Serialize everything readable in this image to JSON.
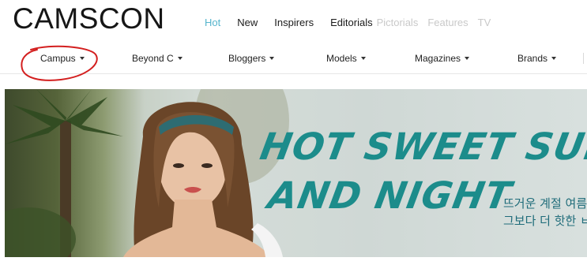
{
  "brand": {
    "logo_text": "CAMSCON"
  },
  "top_nav": {
    "items": [
      {
        "label": "Hot",
        "state": "active"
      },
      {
        "label": "New",
        "state": "normal"
      },
      {
        "label": "Inspirers",
        "state": "normal"
      },
      {
        "label": "Editorials",
        "state": "normal"
      },
      {
        "label": "Pictorials",
        "state": "dimmed"
      },
      {
        "label": "Features",
        "state": "dimmed"
      },
      {
        "label": "TV",
        "state": "dimmed"
      }
    ]
  },
  "sub_nav": {
    "items": [
      {
        "label": "Campus"
      },
      {
        "label": "Beyond C"
      },
      {
        "label": "Bloggers"
      },
      {
        "label": "Models"
      },
      {
        "label": "Magazines"
      },
      {
        "label": "Brands"
      }
    ]
  },
  "hero": {
    "headline_line1": "HOT SWEET SUMME",
    "headline_line2": "AND NIGHT",
    "subtitle_line1": "뜨거운 계절 여름",
    "subtitle_line2": "그보다 더 핫한 ㅂ"
  },
  "colors": {
    "accent": "#57b5cd",
    "headline": "#1c8c8b",
    "annotation": "#d31f1f"
  }
}
